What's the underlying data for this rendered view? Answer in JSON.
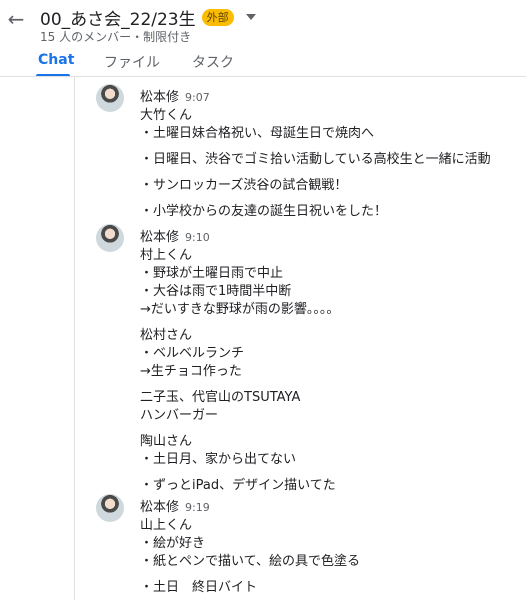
{
  "header": {
    "title": "00_あさ会_22/23生",
    "badge": "外部",
    "subtitle": "15 人のメンバー・制限付き",
    "tabs": [
      "Chat",
      "ファイル",
      "タスク"
    ]
  },
  "messages": [
    {
      "sender": "松本修",
      "time": "9:07",
      "lines": [
        "大竹くん",
        "・土曜日妹合格祝い、母誕生日で焼肉へ",
        "",
        "・日曜日、渋谷でゴミ拾い活動している高校生と一緒に活動",
        "",
        "・サンロッカーズ渋谷の試合観戦！",
        "",
        "・小学校からの友達の誕生日祝いをした！"
      ]
    },
    {
      "sender": "松本修",
      "time": "9:10",
      "lines": [
        "村上くん",
        "・野球が土曜日雨で中止",
        "・大谷は雨で1時間半中断",
        "→だいすきな野球が雨の影響。。。。",
        "",
        "松村さん",
        "・ベルベルランチ",
        "→生チョコ作った",
        "",
        "二子玉、代官山のTSUTAYA",
        "ハンバーガー",
        "",
        "陶山さん",
        "・土日月、家から出てない",
        "",
        "・ずっとiPad、デザイン描いてた"
      ]
    },
    {
      "sender": "松本修",
      "time": "9:19",
      "lines": [
        "山上くん",
        "・絵が好き",
        "・紙とペンで描いて、絵の具で色塗る",
        "",
        "・土日　終日バイト"
      ]
    }
  ]
}
